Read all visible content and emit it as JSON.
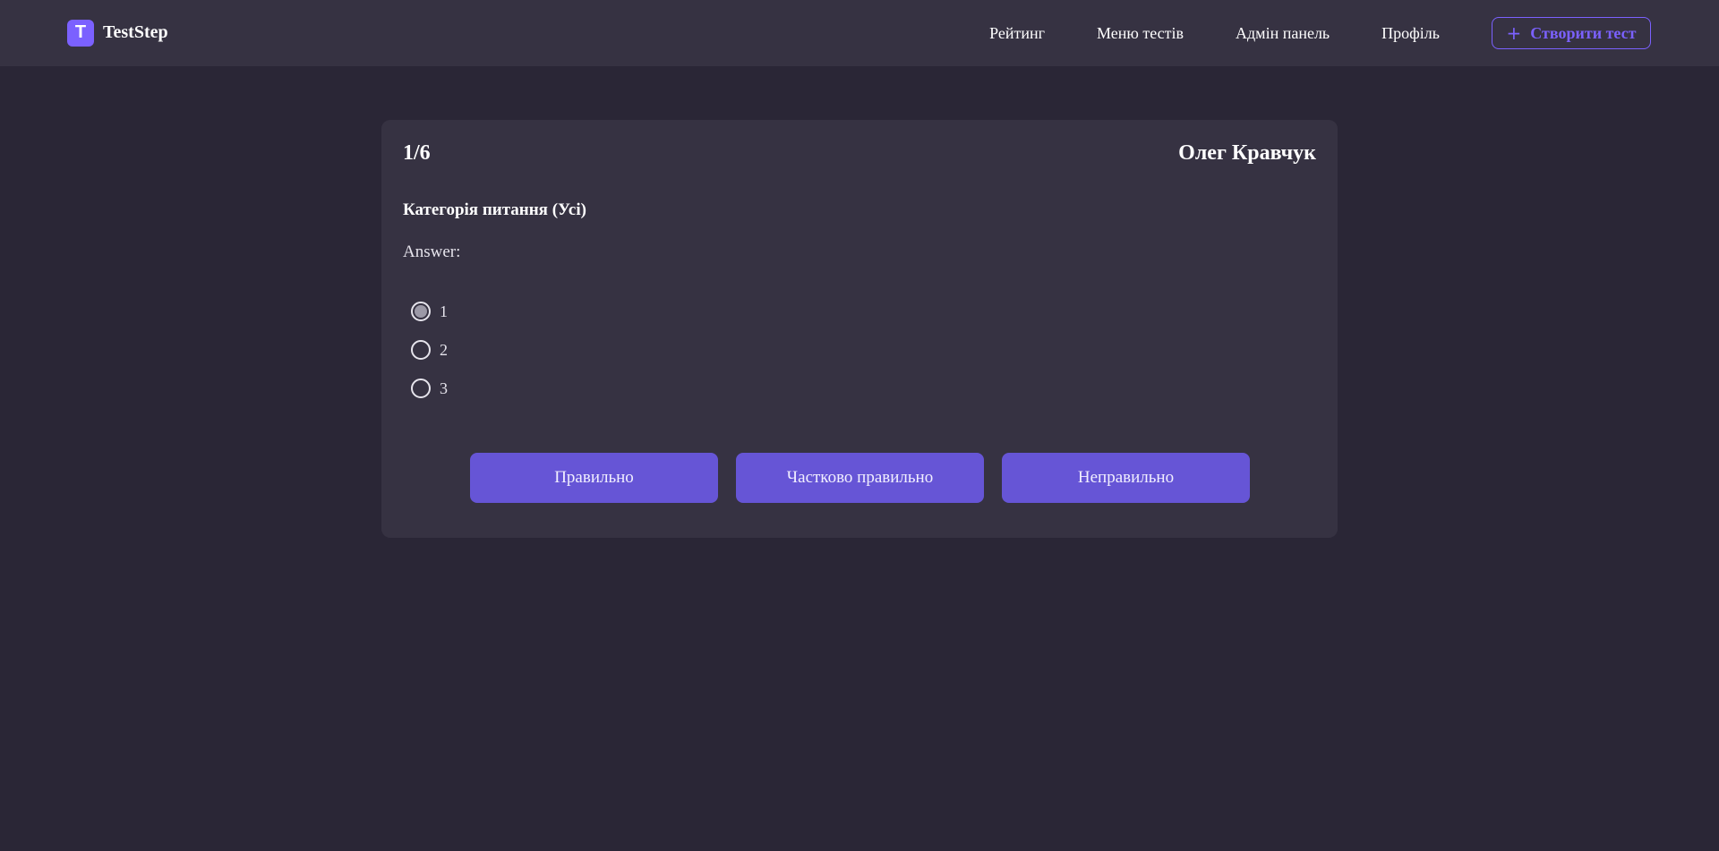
{
  "header": {
    "logo_letter": "T",
    "brand": "TestStep",
    "nav": [
      "Рейтинг",
      "Меню тестів",
      "Адмін панель",
      "Профіль"
    ],
    "create_label": "Створити тест",
    "create_icon": "plus-icon"
  },
  "test": {
    "counter": "1/6",
    "user": "Олег Кравчук",
    "question": "Категорія питання (Усі)",
    "answer_label": "Answer:",
    "options": [
      "1",
      "2",
      "3"
    ],
    "selected_option": "1",
    "buttons": {
      "correct": "Правильно",
      "partial": "Частково правильно",
      "incorrect": "Неправильно"
    }
  },
  "colors": {
    "background": "#2a2636",
    "surface": "#363242",
    "accent": "#7b61ff",
    "button": "#6655d6"
  }
}
